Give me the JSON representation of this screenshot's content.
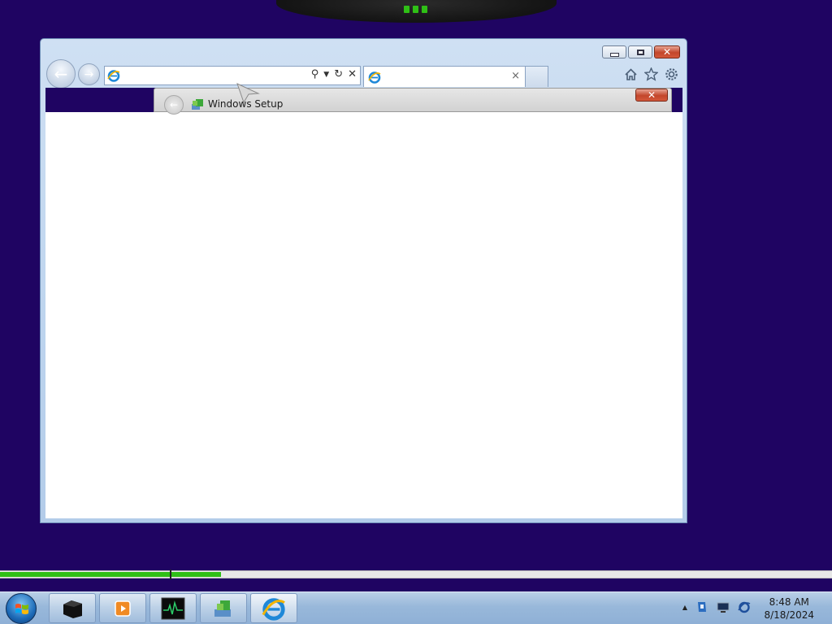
{
  "browser": {
    "address_value": "",
    "address_placeholder": "",
    "tab_title": "",
    "tab_close_glyph": "×"
  },
  "setup_dialog": {
    "title": "Windows Setup"
  },
  "progress": {
    "fraction": 0.266,
    "marker_fraction": 0.204
  },
  "taskbar": {
    "clock_time": "8:48 AM",
    "clock_date": "8/18/2024",
    "pinned": [
      "cmd-icon",
      "media-player-icon",
      "resource-monitor-icon",
      "setup-icon",
      "internet-explorer-icon"
    ]
  },
  "colors": {
    "desktop": "#1f0462",
    "progress": "#2fbf16",
    "close_button": "#c3462b"
  }
}
